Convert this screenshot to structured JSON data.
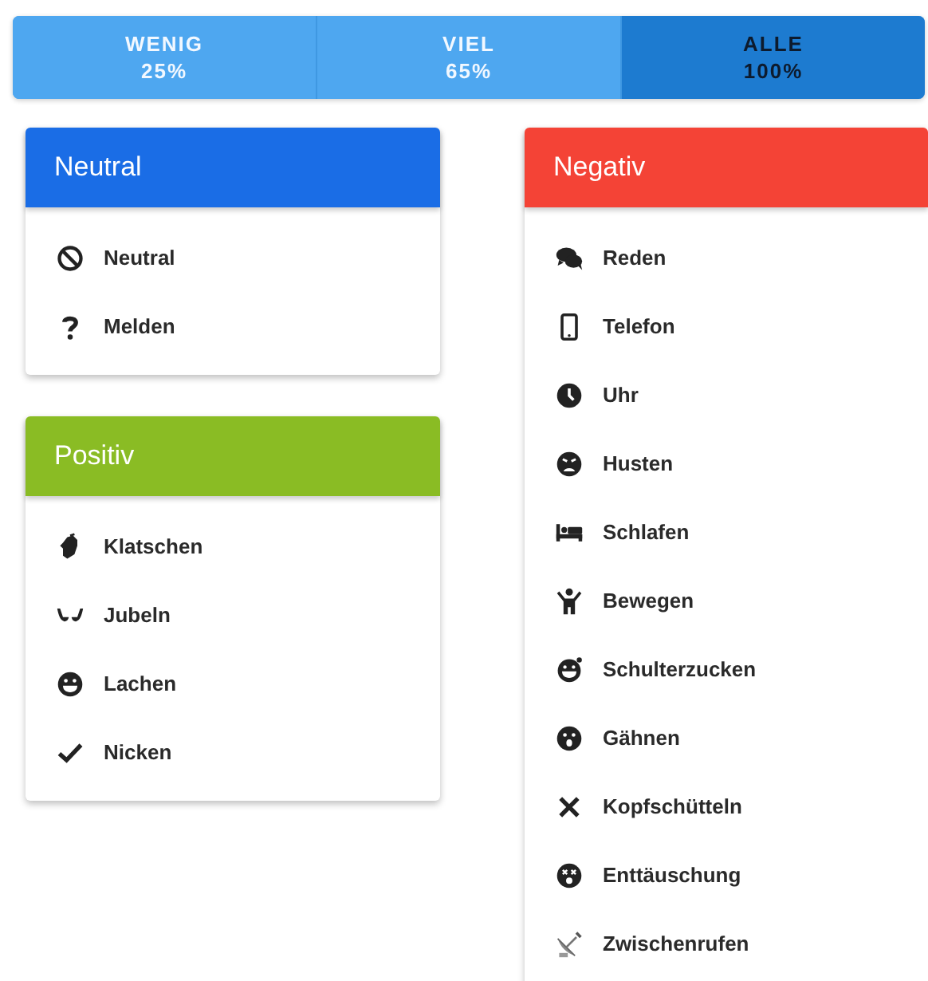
{
  "segments": [
    {
      "label": "WENIG",
      "value": "25%",
      "selected": false
    },
    {
      "label": "VIEL",
      "value": "65%",
      "selected": false
    },
    {
      "label": "ALLE",
      "value": "100%",
      "selected": true
    }
  ],
  "columns": [
    {
      "groups": [
        {
          "title": "Neutral",
          "color": "#1a6de6",
          "items": [
            {
              "label": "Neutral",
              "kind": "ban"
            },
            {
              "label": "Melden",
              "kind": "question"
            }
          ]
        },
        {
          "title": "Positiv",
          "color": "#8abc24",
          "items": [
            {
              "label": "Klatschen",
              "kind": "clap"
            },
            {
              "label": "Jubeln",
              "kind": "hands"
            },
            {
              "label": "Lachen",
              "kind": "grin"
            },
            {
              "label": "Nicken",
              "kind": "check"
            }
          ]
        }
      ]
    },
    {
      "groups": [
        {
          "title": "Negativ",
          "color": "#f44336",
          "items": [
            {
              "label": "Reden",
              "kind": "comments"
            },
            {
              "label": "Telefon",
              "kind": "phone"
            },
            {
              "label": "Uhr",
              "kind": "clock"
            },
            {
              "label": "Husten",
              "kind": "sad"
            },
            {
              "label": "Schlafen",
              "kind": "bed"
            },
            {
              "label": "Bewegen",
              "kind": "child"
            },
            {
              "label": "Schulterzucken",
              "kind": "wink"
            },
            {
              "label": "Gähnen",
              "kind": "surprise"
            },
            {
              "label": "Kopfschütteln",
              "kind": "times"
            },
            {
              "label": "Enttäuschung",
              "kind": "dizzy"
            },
            {
              "label": "Zwischenrufen",
              "kind": "satellite"
            }
          ]
        }
      ]
    }
  ]
}
